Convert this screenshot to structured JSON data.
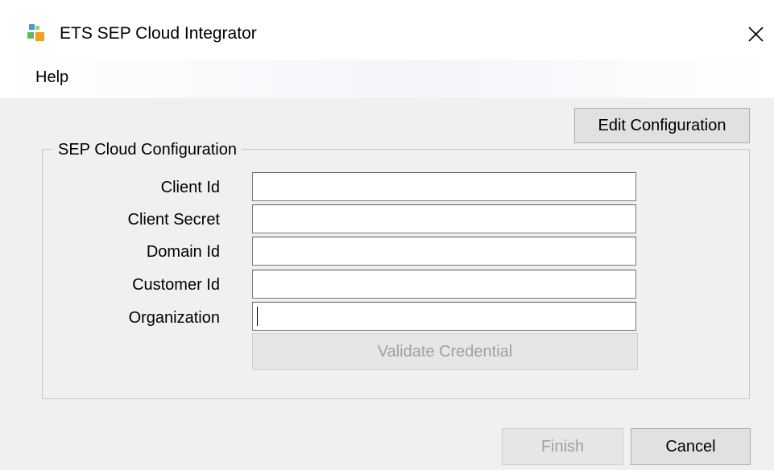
{
  "window": {
    "title": "ETS SEP Cloud Integrator",
    "icon": "app-logo-icon",
    "close_icon": "close-icon"
  },
  "menu": {
    "items": [
      {
        "label": "Help"
      }
    ]
  },
  "toolbar": {
    "edit_configuration_label": "Edit Configuration"
  },
  "config_group": {
    "title": "SEP Cloud Configuration",
    "fields": [
      {
        "label": "Client Id",
        "value": ""
      },
      {
        "label": "Client Secret",
        "value": ""
      },
      {
        "label": "Domain Id",
        "value": ""
      },
      {
        "label": "Customer Id",
        "value": ""
      },
      {
        "label": "Organization",
        "value": ""
      }
    ],
    "validate_label": "Validate Credential"
  },
  "footer": {
    "finish_label": "Finish",
    "cancel_label": "Cancel"
  }
}
